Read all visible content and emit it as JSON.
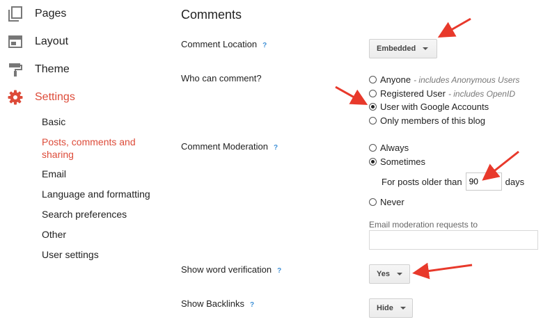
{
  "nav": [
    {
      "label": "Pages",
      "icon": "pages-icon"
    },
    {
      "label": "Layout",
      "icon": "layout-icon"
    },
    {
      "label": "Theme",
      "icon": "theme-icon"
    },
    {
      "label": "Settings",
      "icon": "settings-gear-icon",
      "active": true
    }
  ],
  "subnav": [
    {
      "label": "Basic"
    },
    {
      "label": "Posts, comments and sharing",
      "active": true
    },
    {
      "label": "Email"
    },
    {
      "label": "Language and formatting"
    },
    {
      "label": "Search preferences"
    },
    {
      "label": "Other"
    },
    {
      "label": "User settings"
    }
  ],
  "section_title": "Comments",
  "help_glyph": "?",
  "comment_location": {
    "label": "Comment Location",
    "value": "Embedded"
  },
  "who_can_comment": {
    "label": "Who can comment?",
    "options": [
      {
        "label": "Anyone",
        "note": "- includes Anonymous Users",
        "selected": false
      },
      {
        "label": "Registered User",
        "note": "- includes OpenID",
        "selected": false
      },
      {
        "label": "User with Google Accounts",
        "note": "",
        "selected": true
      },
      {
        "label": "Only members of this blog",
        "note": "",
        "selected": false
      }
    ]
  },
  "comment_moderation": {
    "label": "Comment Moderation",
    "options": [
      {
        "label": "Always",
        "selected": false
      },
      {
        "label": "Sometimes",
        "selected": true
      },
      {
        "label": "Never",
        "selected": false
      }
    ],
    "older_than_prefix": "For posts older than",
    "older_than_value": "90",
    "older_than_suffix": "days",
    "email_label": "Email moderation requests to",
    "email_value": ""
  },
  "word_verification": {
    "label": "Show word verification",
    "value": "Yes"
  },
  "backlinks": {
    "label": "Show Backlinks",
    "value": "Hide"
  },
  "colors": {
    "accent": "#dd4b39",
    "help": "#3d8fd6",
    "annotation_arrow": "#e8392b"
  }
}
